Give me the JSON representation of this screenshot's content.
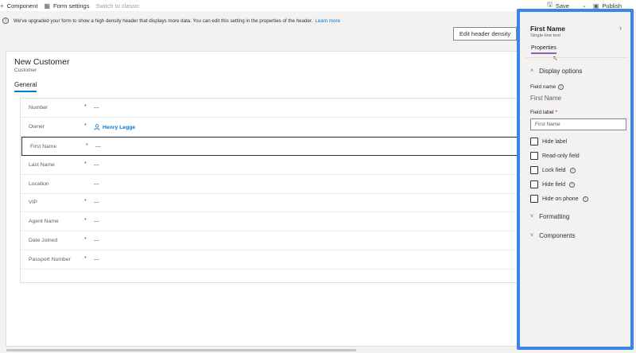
{
  "commandbar": {
    "component": "Component",
    "form_settings": "Form settings",
    "switch_classic": "Switch to classic",
    "save": "Save",
    "publish": "Publish"
  },
  "banner": {
    "text": "We've upgraded your form to show a high density header that displays more data. You can edit this setting in the properties of the header.",
    "link": "Learn more"
  },
  "edit_header_density": "Edit header density",
  "form": {
    "title": "New Customer",
    "subtitle": "Customer",
    "tab": "General",
    "fields": [
      {
        "label": "Number",
        "required": "*",
        "value": "---"
      },
      {
        "label": "Owner",
        "required": "*",
        "value": "Henry Legge"
      },
      {
        "label": "First Name",
        "required": "*",
        "value": "---"
      },
      {
        "label": "Last Name",
        "required": "*",
        "value": "---"
      },
      {
        "label": "Location",
        "required": "",
        "value": "---"
      },
      {
        "label": "VIP",
        "required": "*",
        "value": "---"
      },
      {
        "label": "Agent Name",
        "required": "*",
        "value": "---"
      },
      {
        "label": "Date Joined",
        "required": "*",
        "value": "---"
      },
      {
        "label": "Passport Number",
        "required": "*",
        "value": "---"
      }
    ]
  },
  "panel": {
    "title": "First Name",
    "subtitle": "Single-line text",
    "tab": "Properties",
    "display_options": "Display options",
    "field_name_label": "Field name",
    "field_name_value": "First Name",
    "field_label_label": "Field label",
    "field_label_required": "*",
    "field_label_value": "First Name",
    "checkboxes": [
      "Hide label",
      "Read-only field",
      "Lock field",
      "Hide field",
      "Hide on phone"
    ],
    "formatting": "Formatting",
    "components": "Components"
  },
  "colors": {
    "accent": "#0078d4",
    "panel_highlight": "#3a86e8",
    "tab_underline": "#8764b8",
    "required": "#a4262c"
  }
}
